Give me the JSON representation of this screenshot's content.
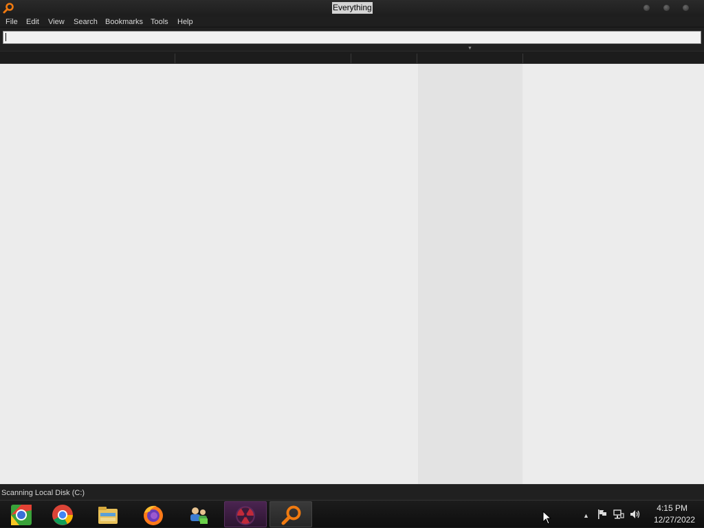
{
  "window": {
    "title": "Everything",
    "menu": [
      "File",
      "Edit",
      "View",
      "Search",
      "Bookmarks",
      "Tools",
      "Help"
    ]
  },
  "search": {
    "value": ""
  },
  "status": {
    "text": "Scanning Local Disk (C:)"
  },
  "taskbar": {
    "apps": [
      {
        "name": "chromium-icon",
        "active": false
      },
      {
        "name": "chrome-icon",
        "active": false
      },
      {
        "name": "file-explorer-icon",
        "active": false
      },
      {
        "name": "firefox-icon",
        "active": false
      },
      {
        "name": "network-users-icon",
        "active": false
      },
      {
        "name": "radiation-app-icon",
        "active": false
      },
      {
        "name": "everything-search-icon",
        "active": true
      }
    ],
    "clock": {
      "time": "4:15 PM",
      "date": "12/27/2022"
    }
  },
  "colors": {
    "accent": "#f07a10",
    "titlebar": "#202020",
    "results_bg": "#ececec"
  }
}
